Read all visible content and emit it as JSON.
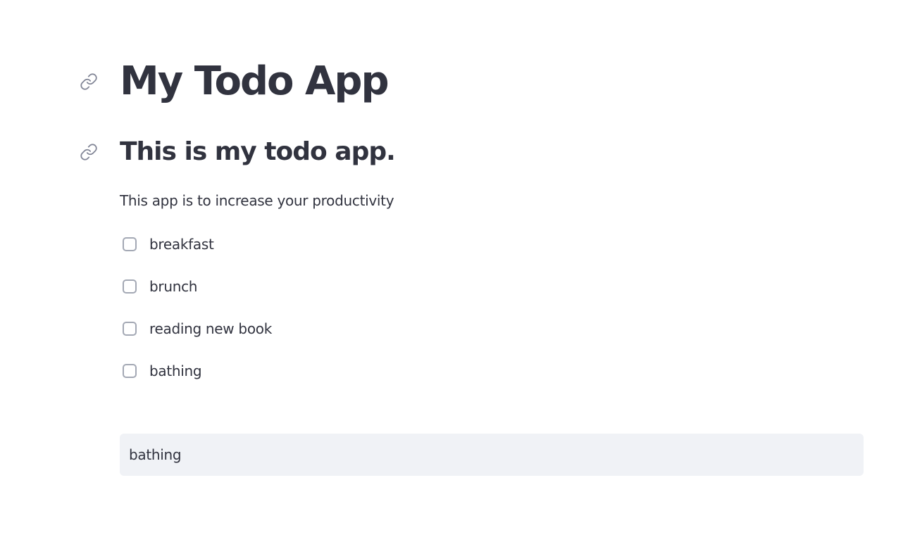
{
  "app": {
    "title": "My Todo App",
    "subtitle": "This is my todo app.",
    "description": "This app is to increase your productivity"
  },
  "icons": {
    "title_anchor": "link-icon",
    "subtitle_anchor": "link-icon"
  },
  "todos": [
    {
      "label": "breakfast",
      "checked": false
    },
    {
      "label": "brunch",
      "checked": false
    },
    {
      "label": "reading new book",
      "checked": false
    },
    {
      "label": "bathing",
      "checked": false
    }
  ],
  "new_todo_input": {
    "value": "bathing"
  },
  "colors": {
    "text": "#31333f",
    "input_background": "#f0f2f6",
    "checkbox_border": "#a3a8b4",
    "icon": "#808495"
  }
}
